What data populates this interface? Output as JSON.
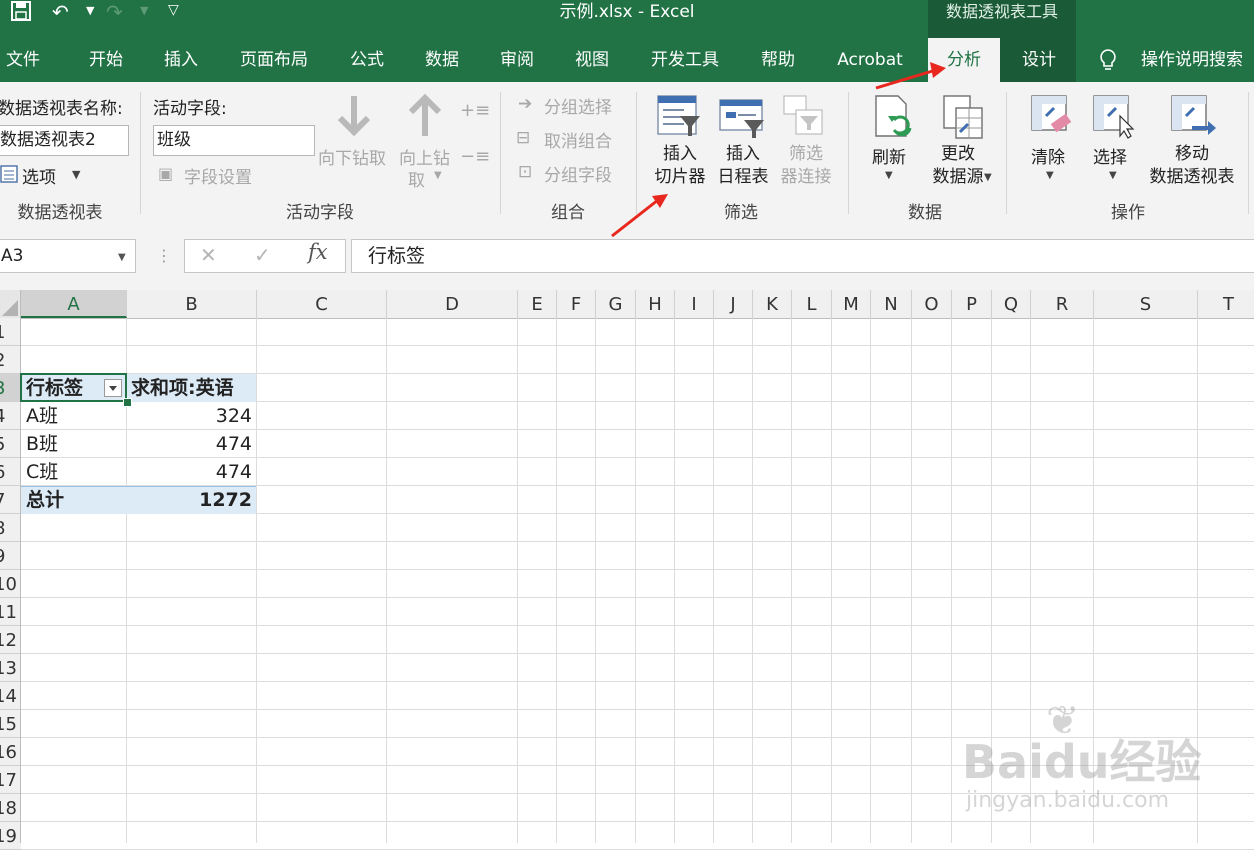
{
  "titlebar": {
    "document_title": "示例.xlsx  -  Excel",
    "contextual_tools": "数据透视表工具"
  },
  "tabs": [
    "文件",
    "开始",
    "插入",
    "页面布局",
    "公式",
    "数据",
    "审阅",
    "视图",
    "开发工具",
    "帮助",
    "Acrobat",
    "分析",
    "设计",
    "操作说明搜索"
  ],
  "active_tab": "分析",
  "ribbon": {
    "pivot_name_label": "数据透视表名称:",
    "pivot_name_value": "数据透视表2",
    "options_label": "选项",
    "group_pivot": "数据透视表",
    "active_field_label": "活动字段:",
    "active_field_value": "班级",
    "field_settings": "字段设置",
    "drill_down": "向下钻取",
    "drill_up_1": "向上钻",
    "drill_up_2": "取",
    "group_active_field": "活动字段",
    "group_selection": "分组选择",
    "ungroup": "取消组合",
    "group_field": "分组字段",
    "group_group": "组合",
    "insert_slicer_1": "插入",
    "insert_slicer_2": "切片器",
    "insert_timeline_1": "插入",
    "insert_timeline_2": "日程表",
    "filter_conn_1": "筛选",
    "filter_conn_2": "器连接",
    "group_filter": "筛选",
    "refresh": "刷新",
    "change_source_1": "更改",
    "change_source_2": "数据源",
    "group_data": "数据",
    "clear": "清除",
    "select": "选择",
    "move_1": "移动",
    "move_2": "数据透视表",
    "group_actions": "操作"
  },
  "formula_bar": {
    "name_box": "A3",
    "formula": "行标签"
  },
  "columns": [
    "A",
    "B",
    "C",
    "D",
    "E",
    "F",
    "G",
    "H",
    "I",
    "J",
    "K",
    "L",
    "M",
    "N",
    "O",
    "P",
    "Q",
    "R",
    "S",
    "T"
  ],
  "rows": [
    "1",
    "2",
    "3",
    "4",
    "5",
    "6",
    "7",
    "8",
    "9",
    "10",
    "11",
    "12",
    "13",
    "14",
    "15",
    "16",
    "17",
    "18",
    "19"
  ],
  "pivot": {
    "header_row_label": "行标签",
    "header_value": "求和项:英语",
    "items": [
      {
        "label": "A班",
        "value": "324"
      },
      {
        "label": "B班",
        "value": "474"
      },
      {
        "label": "C班",
        "value": "474"
      }
    ],
    "total_label": "总计",
    "total_value": "1272"
  },
  "watermark": {
    "brand": "Baidu经验",
    "url": "jingyan.baidu.com"
  },
  "colors": {
    "excel_green": "#217346",
    "pivot_header_fill": "#ddebf7",
    "annotation_red": "#e8281e"
  }
}
